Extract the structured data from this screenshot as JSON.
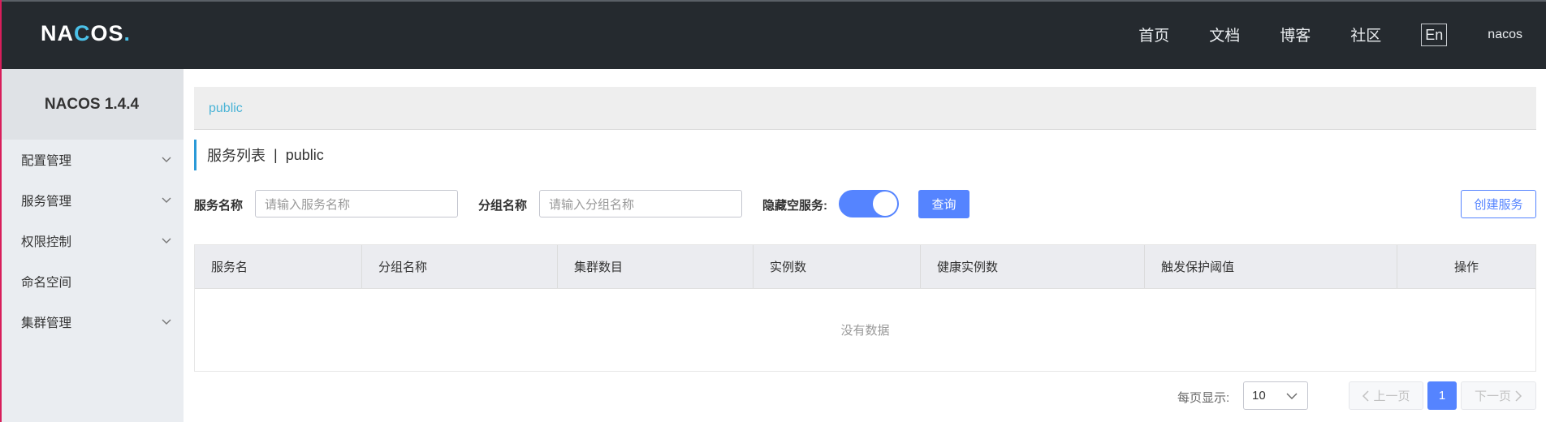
{
  "header": {
    "logo_parts": [
      "NA",
      "C",
      "OS",
      "."
    ],
    "nav": [
      "首页",
      "文档",
      "博客",
      "社区"
    ],
    "lang_button": "En",
    "user": "nacos"
  },
  "sidebar": {
    "title": "NACOS 1.4.4",
    "items": [
      {
        "label": "配置管理"
      },
      {
        "label": "服务管理"
      },
      {
        "label": "权限控制"
      },
      {
        "label": "命名空间"
      },
      {
        "label": "集群管理"
      }
    ]
  },
  "breadcrumb": {
    "namespace": "public"
  },
  "page": {
    "title": "服务列表",
    "separator": "|",
    "namespace": "public"
  },
  "filters": {
    "service_name_label": "服务名称",
    "service_name_placeholder": "请输入服务名称",
    "group_name_label": "分组名称",
    "group_name_placeholder": "请输入分组名称",
    "hide_empty_label": "隐藏空服务:",
    "hide_empty_on": true,
    "query_button": "查询",
    "create_button": "创建服务"
  },
  "table": {
    "columns": [
      "服务名",
      "分组名称",
      "集群数目",
      "实例数",
      "健康实例数",
      "触发保护阈值",
      "操作"
    ],
    "empty_text": "没有数据"
  },
  "pagination": {
    "page_size_label": "每页显示:",
    "page_size": "10",
    "prev": "上一页",
    "current": "1",
    "next": "下一页"
  },
  "colors": {
    "accent": "#5584ff",
    "header_bg": "#252a2f",
    "sidebar_bg": "#eaedf1"
  }
}
